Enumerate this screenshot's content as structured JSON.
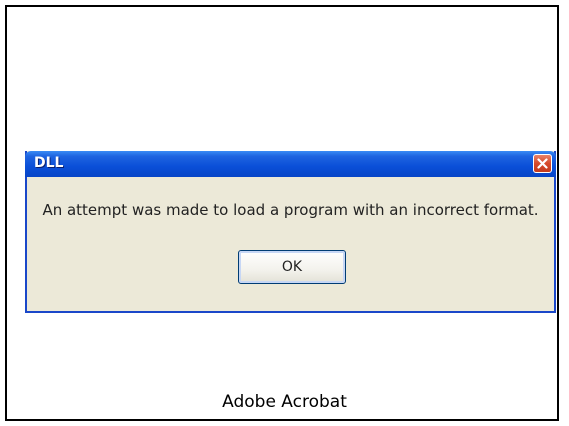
{
  "dialog": {
    "title": "DLL",
    "message": "An attempt was made to load a program with an incorrect format.",
    "ok_label": "OK",
    "close_icon": "close-icon"
  },
  "caption": "Adobe Acrobat",
  "colors": {
    "titlebar": "#0a4fd8",
    "dialog_background": "#ece9d8",
    "close_button": "#d6492a"
  }
}
